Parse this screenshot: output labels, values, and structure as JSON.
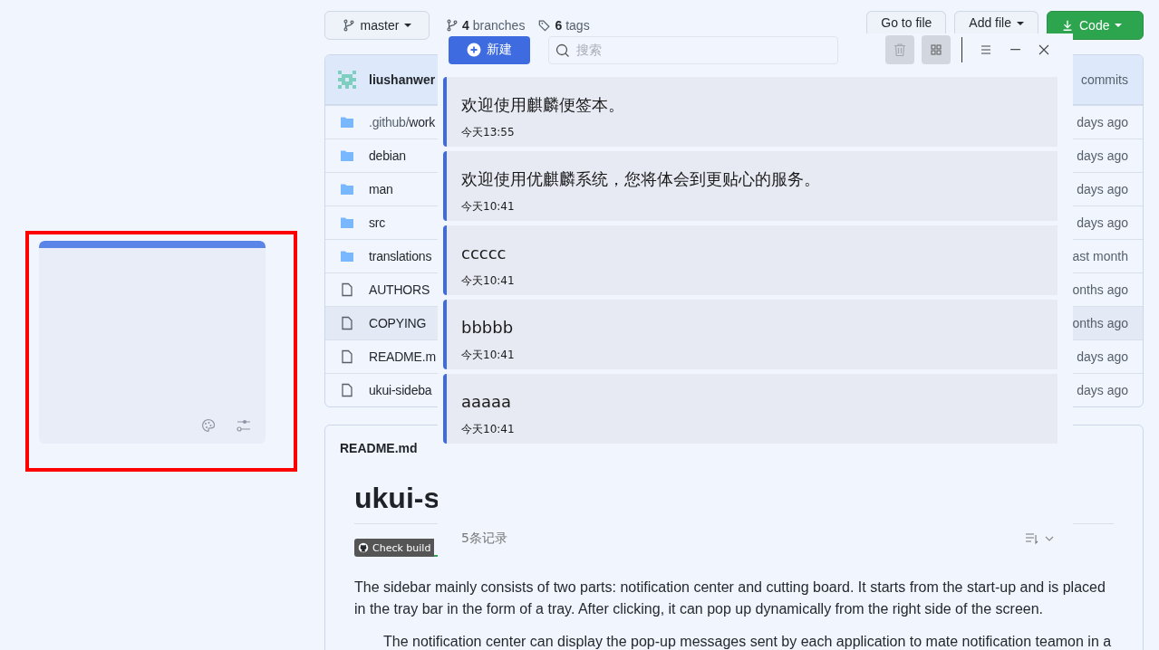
{
  "repo": {
    "branch": "master",
    "branches": {
      "count": "4",
      "label": "branches"
    },
    "tags": {
      "count": "6",
      "label": "tags"
    },
    "buttons": [
      "Go to file",
      "Add file"
    ],
    "code_button": "Code",
    "latest_commit": {
      "author": "liushanwer",
      "commits": "commits"
    },
    "files": [
      {
        "kind": "folder",
        "prefix": ".github/",
        "name": "work",
        "age": "days ago",
        "hovered": false
      },
      {
        "kind": "folder",
        "name": "debian",
        "age": "days ago",
        "hovered": false
      },
      {
        "kind": "folder",
        "name": "man",
        "age": "days ago",
        "hovered": false
      },
      {
        "kind": "folder",
        "name": "src",
        "age": "days ago",
        "hovered": false
      },
      {
        "kind": "folder",
        "name": "translations",
        "age": "ast month",
        "hovered": false
      },
      {
        "kind": "file",
        "name": "AUTHORS",
        "age": "onths ago",
        "hovered": false
      },
      {
        "kind": "file",
        "name": "COPYING",
        "age": "onths ago",
        "hovered": true
      },
      {
        "kind": "file",
        "name": "README.m",
        "age": "days ago",
        "hovered": false
      },
      {
        "kind": "file",
        "name": "ukui-sideba",
        "age": "days ago",
        "hovered": false
      }
    ],
    "readme": {
      "title": "README.md",
      "heading": "ukui-s",
      "badge": "Check build",
      "paragraphs": [
        "The sidebar mainly consists of two parts: notification center and cutting board. It starts from the start-up and is placed in the tray bar in the form of a tray. After clicking, it can pop up dynamically from the right side of the screen.",
        "The notification center can display the pop-up messages sent by each application to mate notification teamon in a"
      ]
    }
  },
  "notes_window": {
    "new_button": "新建",
    "search": {
      "placeholder": "搜索"
    },
    "notes": [
      {
        "text": "欢迎使用麒麟便签本。",
        "time": "今天13:55"
      },
      {
        "text": "欢迎使用优麒麟系统，您将体会到更贴心的服务。",
        "time": "今天10:41"
      },
      {
        "text": "ccccc",
        "time": "今天10:41"
      },
      {
        "text": "bbbbb",
        "time": "今天10:41"
      },
      {
        "text": "aaaaa",
        "time": "今天10:41"
      }
    ],
    "count": "5条记录"
  }
}
